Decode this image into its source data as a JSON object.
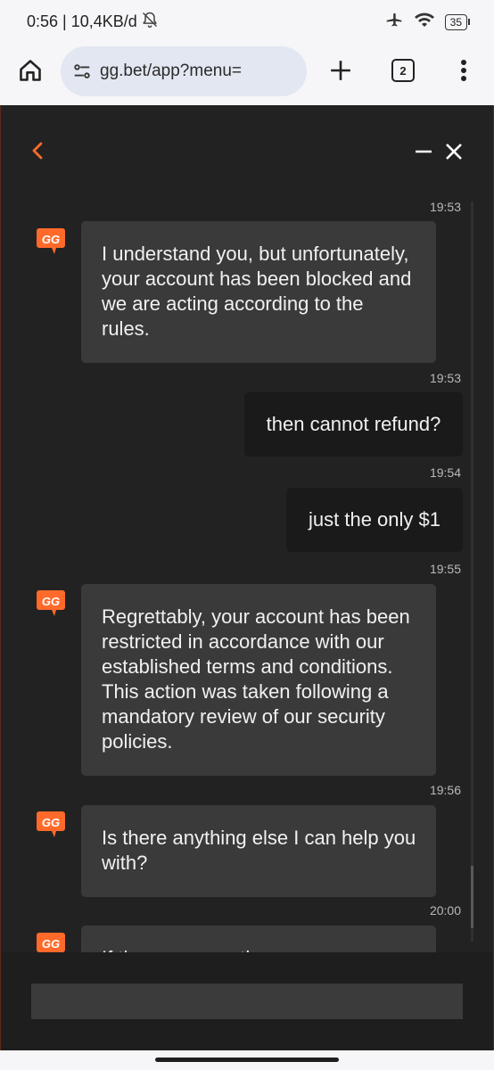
{
  "status_bar": {
    "time_info": "0:56 | 10,4KB/d",
    "battery": "35",
    "icons": [
      "bell-off-icon",
      "airplane-icon",
      "wifi-icon",
      "battery-icon"
    ]
  },
  "browser": {
    "url": "gg.bet/app?menu=",
    "tab_count": "2",
    "icons": [
      "home-icon",
      "site-settings-icon",
      "plus-icon",
      "tabs-icon",
      "more-vert-icon"
    ]
  },
  "chat": {
    "accent_color": "#ff6a2b",
    "icons": [
      "back-chevron-icon",
      "minimize-icon",
      "close-icon",
      "gg-logo"
    ],
    "logo_text": "GG",
    "messages": [
      {
        "time": "19:53",
        "sender": "agent",
        "text": "I understand you, but unfortunately, your account has been blocked and we are acting according to the rules."
      },
      {
        "time": "19:53",
        "sender": "user",
        "text": "then cannot refund?"
      },
      {
        "time": "19:54",
        "sender": "user",
        "text": "just the only $1"
      },
      {
        "time": "19:55",
        "sender": "agent",
        "text": "Regrettably, your account has been restricted in accordance with our established terms and conditions. This action was taken following a mandatory review of our security policies."
      },
      {
        "time": "19:56",
        "sender": "agent",
        "text": "Is there anything else I can help you with?"
      },
      {
        "time": "20:00",
        "sender": "agent",
        "text": "If there are no other"
      }
    ],
    "composer": {
      "placeholder": ""
    }
  }
}
